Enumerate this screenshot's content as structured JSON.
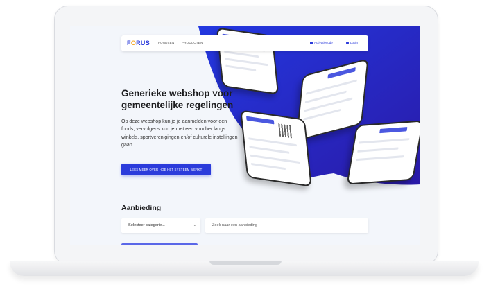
{
  "navbar": {
    "logo": "F",
    "logo_o": "O",
    "logo_rest": "RUS",
    "links": [
      "FONDSEN",
      "PRODUCTEN"
    ],
    "account_label": "Activatiecode",
    "login_label": "Login"
  },
  "hero": {
    "title": "Generieke webshop voor gemeentelijke regelingen",
    "text": "Op deze webshop kun je je aanmelden voor een fonds, vervolgens kun je met een voucher langs winkels, sportverenigingen en/of culturele instellingen gaan.",
    "cta_label": "LEES MEER OVER HOE HET SYSTEEM WERKT"
  },
  "offers": {
    "title": "Aanbieding",
    "category_select": "Selecteer categorie...",
    "search_placeholder": "Zoek naar een aanbieding"
  },
  "colors": {
    "brand_blue": "#2b3bdb",
    "logo_accent": "#f5a623"
  },
  "icons": {
    "account": "card-icon",
    "login": "user-icon",
    "select": "chevron-down-icon"
  }
}
